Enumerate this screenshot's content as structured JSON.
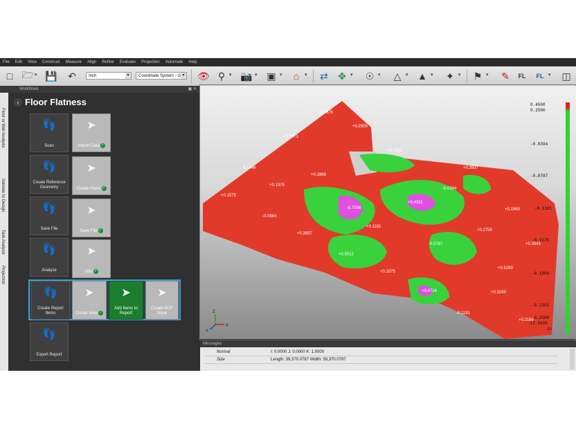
{
  "menu": [
    "File",
    "Edit",
    "View",
    "Construct",
    "Measure",
    "Align",
    "Refine",
    "Evaluate",
    "Projection",
    "Automate",
    "Help"
  ],
  "toolbar": {
    "units": "Inch",
    "coordinate_system": "Coordinate System - Gric",
    "fl_label": "FL"
  },
  "workflows": {
    "header": "Workflows",
    "title": "Floor Flatness",
    "side_tabs": [
      "Floor or Wall Analysis",
      "Validate to Design",
      "Task Analysis",
      "Projection"
    ],
    "steps": [
      {
        "label": "Scan",
        "subs": [
          {
            "label": "Import Data",
            "checked": true
          }
        ]
      },
      {
        "label": "Create Reference Geometry",
        "subs": [
          {
            "label": "Create Plane",
            "checked": true
          }
        ]
      },
      {
        "label": "Save File",
        "subs": [
          {
            "label": "Save File",
            "checked": true
          }
        ]
      },
      {
        "label": "Analyze",
        "subs": [
          {
            "label": "Grid",
            "checked": true
          }
        ]
      },
      {
        "label": "Create Report Items",
        "subs": [
          {
            "label": "Create View",
            "checked": true
          },
          {
            "label": "Add Items to Report",
            "checked": false
          },
          {
            "label": "Create BCF Issue",
            "checked": false
          }
        ]
      },
      {
        "label": "Export Report",
        "subs": []
      }
    ]
  },
  "legend": {
    "top_values": [
      "0.4500",
      "0.2500"
    ],
    "ticks": [
      "-0.0394",
      "-0.0787",
      "-0.1181",
      "-0.1575",
      "-0.1969",
      "-0.2362",
      "-0.2500",
      "-13.6696"
    ],
    "unit": "in",
    "colors": {
      "high": "#e02020",
      "mid": "#32d232",
      "low": "#e040e0"
    }
  },
  "viewport": {
    "point_labels": [
      "+0.2676",
      "+0.3071",
      "-0.1346",
      "+0.1575",
      "-0.0984",
      "+0.1969",
      "-0.7036",
      "+0.1181",
      "+0.4331",
      "-0.0394",
      "+0.3937",
      "+0.2362",
      "-0.0787",
      "+0.2756",
      "+0.1969",
      "+0.3543",
      "+0.5512",
      "+0.1575",
      "+0.4724",
      "-0.1181",
      "+0.3150",
      "+0.2165",
      "+0.3937",
      "+0.1378",
      "+0.6299",
      "+0.2559"
    ],
    "axis": {
      "x": "X",
      "y": "Y",
      "z": "Z"
    }
  },
  "messages": {
    "header": "Messages",
    "rows": [
      {
        "key": "Normal",
        "value": "I: 0.0000 J: 0.0000 K: 1.0000"
      },
      {
        "key": "Size",
        "value": "Length: 39,370.0787 Width: 39,370.0787"
      }
    ]
  }
}
